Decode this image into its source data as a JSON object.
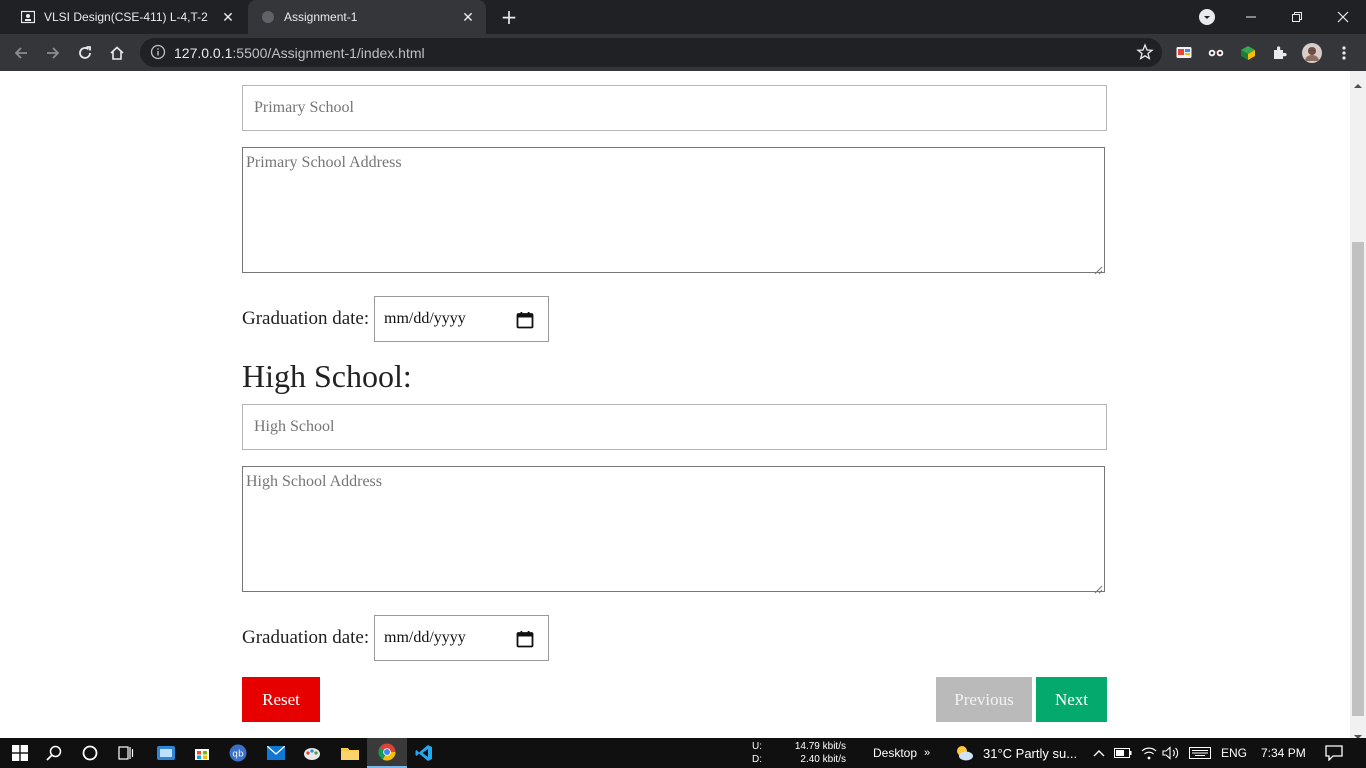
{
  "browser": {
    "tabs": [
      {
        "title": "VLSI Design(CSE-411) L-4,T-2",
        "active": false
      },
      {
        "title": "Assignment-1",
        "active": true
      }
    ],
    "url_host": "127.0.0.1",
    "url_path": ":5500/Assignment-1/index.html"
  },
  "form": {
    "primary": {
      "school_placeholder": "Primary School",
      "address_placeholder": "Primary School Address",
      "grad_label": "Graduation date:",
      "date_placeholder": "mm/dd/yyyy"
    },
    "high": {
      "heading": "High School:",
      "school_placeholder": "High School",
      "address_placeholder": "High School Address",
      "grad_label": "Graduation date:",
      "date_placeholder": "mm/dd/yyyy"
    },
    "buttons": {
      "reset": "Reset",
      "previous": "Previous",
      "next": "Next"
    }
  },
  "taskbar": {
    "net_up_label": "U:",
    "net_up_value": "14.79 kbit/s",
    "net_down_label": "D:",
    "net_down_value": "2.40 kbit/s",
    "desktop_label": "Desktop",
    "weather": "31°C  Partly su...",
    "language": "ENG",
    "time": "7:34 PM"
  },
  "colors": {
    "reset": "#e60000",
    "previous": "#bababa",
    "next": "#04aa6d",
    "chrome_dark": "#202124",
    "chrome_toolbar": "#35363a"
  }
}
